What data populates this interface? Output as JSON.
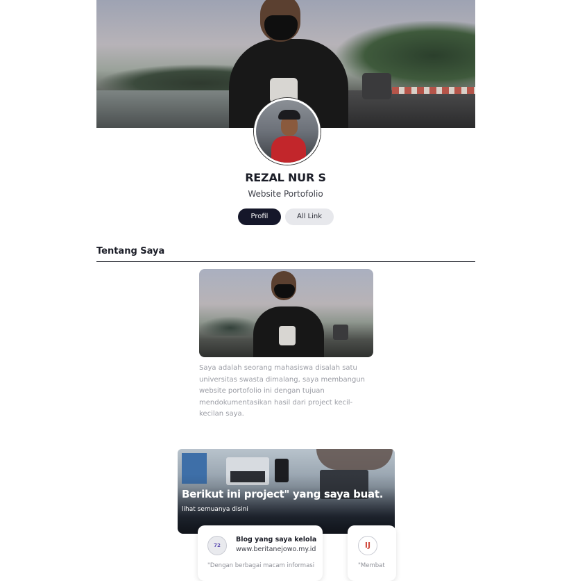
{
  "profile": {
    "name": "REZAL NUR S",
    "subtitle": "Website Portofolio"
  },
  "tabs": [
    {
      "label": "Profil",
      "active": true
    },
    {
      "label": "All Link",
      "active": false
    }
  ],
  "about": {
    "heading": "Tentang Saya",
    "text": "Saya adalah seorang mahasiswa disalah satu universitas swasta dimalang, saya membangun website portofolio ini dengan tujuan mendokumentasikan hasil dari project kecil-kecilan saya."
  },
  "projects": {
    "banner_title": "Berikut ini project\" yang saya buat.",
    "banner_subtitle": "lihat semuanya disini",
    "cards": [
      {
        "title": "Blog yang saya kelola",
        "url": "www.beritanejowo.my.id",
        "description": "\"Dengan berbagai macam informasi",
        "logo_text": "72"
      },
      {
        "title": "",
        "url": "",
        "description": "\"Membat",
        "logo_text": "IJ"
      }
    ]
  },
  "colors": {
    "primary_dark": "#15172a",
    "pill_light": "#e7e8ec",
    "text_muted": "#9a9ca4",
    "card_logo_accent": "#d14a3d"
  }
}
